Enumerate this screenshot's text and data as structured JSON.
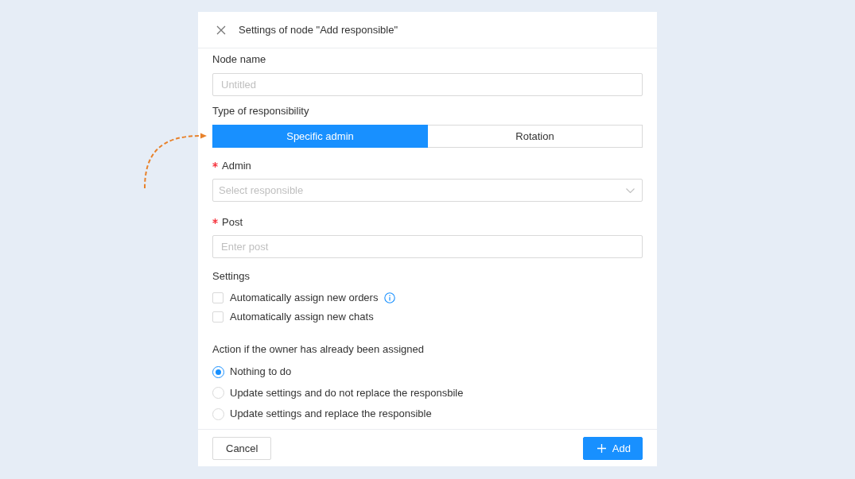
{
  "dialog": {
    "title": "Settings of node \"Add responsible\""
  },
  "node_name": {
    "label": "Node name",
    "placeholder": "Untitled"
  },
  "responsibility_type": {
    "label": "Type of responsibility",
    "options": [
      {
        "label": "Specific admin",
        "selected": true
      },
      {
        "label": "Rotation",
        "selected": false
      }
    ]
  },
  "admin": {
    "label": "Admin",
    "required": true,
    "placeholder": "Select responsible"
  },
  "post": {
    "label": "Post",
    "required": true,
    "placeholder": "Enter post"
  },
  "settings": {
    "label": "Settings",
    "options": [
      {
        "label": "Automatically assign new orders",
        "checked": false,
        "info": true
      },
      {
        "label": "Automatically assign new chats",
        "checked": false,
        "info": false
      }
    ]
  },
  "owner_action": {
    "label": "Action if the owner has already been assigned",
    "options": [
      {
        "label": "Nothing to do",
        "selected": true
      },
      {
        "label": "Update settings and do not replace the responsbile",
        "selected": false
      },
      {
        "label": "Update settings and replace the responsible",
        "selected": false
      }
    ]
  },
  "footer": {
    "buttons": [
      {
        "label": "Cancel",
        "kind": "secondary"
      },
      {
        "label": "Add",
        "kind": "primary"
      }
    ]
  }
}
